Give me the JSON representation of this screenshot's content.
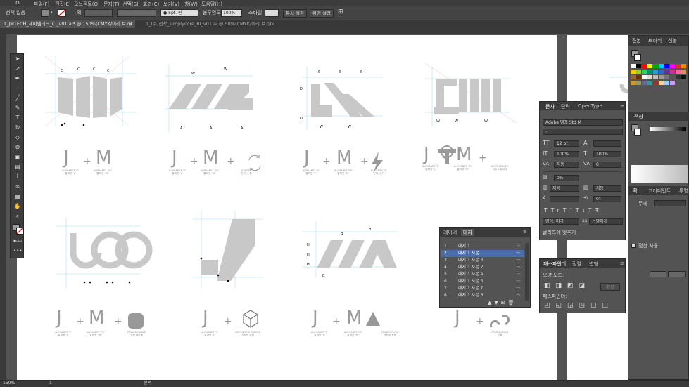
{
  "menubar": {
    "items": [
      "파일(F)",
      "편집(E)",
      "오브젝트(O)",
      "문자(T)",
      "선택(S)",
      "효과(C)",
      "보기(V)",
      "창(W)",
      "도움말(H)"
    ]
  },
  "control": {
    "selection": "선택 없음",
    "stroke_label": "획",
    "stroke_size": "5pt. 원",
    "opacity_label": "불투명도",
    "opacity_value": "100%",
    "style_label": "스타일",
    "doc_setup": "문서 설정",
    "preferences": "환경 설정"
  },
  "tabs": [
    {
      "label": "1_JMTECH_제이엠테크_CI_v01.ai* @ 150%(CMYK/미리 보기)",
      "close": "×"
    },
    {
      "label": "1_(주)선착_simplycore_BI_v01.ai @ 50%(CMYK/미리 보기)",
      "close": "×"
    }
  ],
  "artboard": {
    "row1": [
      {
        "glyphs": [
          "J",
          "+",
          "M"
        ],
        "labels": [
          "ALPHABET \"J\"\n알파벳 \"J\"",
          "ALPHABET \"M\"\n알파벳 \"M\""
        ],
        "extra": ""
      },
      {
        "glyphs": [
          "J",
          "+",
          "M",
          "+"
        ],
        "labels": [
          "ALPHABET \"J\"\n알파벳 \"J\"",
          "ALPHABET \"M\"\n알파벳 \"M\"",
          "REPEAT\n반복, 순환"
        ],
        "extra": "repeat"
      },
      {
        "glyphs": [
          "J",
          "+",
          "M",
          "+"
        ],
        "labels": [
          "ALPHABET \"J\"\n알파벳 \"J\"",
          "ALPHABET \"M\"\n알파벳 \"M\"",
          "ELECTRICAL\n전력, 전기"
        ],
        "extra": "bolt"
      },
      {
        "glyphs": [
          "J",
          "+",
          "M",
          "+"
        ],
        "labels": [
          "ALPHABET \"J\"\n알파벳 \"J\"",
          "ALPHABET \"M\"\n알파벳 \"M\"",
          "DUCT SPACER\n덕트 스페이서"
        ],
        "extra": "spacer"
      }
    ],
    "row2": [
      {
        "glyphs": [
          "J",
          "+",
          "M",
          "+"
        ],
        "labels": [
          "ALPHABET \"J\"\n알파벳 \"J\"",
          "ALPHABET \"M\"\n알파벳 \"M\"",
          "POWER CABLE\n전력 케이블"
        ],
        "extra": "cable"
      },
      {
        "glyphs": [
          "J",
          "+"
        ],
        "labels": [
          "ALPHABET \"J\"\n알파벳 \"J\"",
          "GEOMETRIC MOTIVE\n기하학 모형"
        ],
        "extra": "cube"
      },
      {
        "glyphs": [
          "J",
          "+",
          "M",
          "+"
        ],
        "labels": [
          "ALPHABET \"J\"\n알파벳 \"J\"",
          "ALPHABET \"M\"\n알파벳 \"M\"",
          "POWER FLOW\n전력의 흐름"
        ],
        "extra": "warn"
      },
      {
        "glyphs": [
          "J",
          "+"
        ],
        "labels": [
          "ALPHABET \"J\"\n알파벳 \"J\"",
          "CONNECTION\n연결"
        ],
        "extra": "link"
      }
    ],
    "dims": {
      "c": "C",
      "w": "W",
      "a": "A",
      "s": "S",
      "d": "D",
      "h": "H",
      "b": "B"
    }
  },
  "char_panel": {
    "tabs": [
      "문자",
      "단락",
      "OpenType"
    ],
    "font": "Adobe 명조 Std M",
    "style": "-",
    "size": "12 pt",
    "h_scale": "100%",
    "v_scale": "100%",
    "tracking": "자동",
    "kerning": "0",
    "baseline": "0%",
    "auto1": "자동",
    "auto2": "자동",
    "rotation": "0°",
    "lang": "영어: 미국",
    "aa": "선명하게",
    "glyph_label": "글리프에 맞추기"
  },
  "layers_panel": {
    "tabs": [
      "레이어",
      "대지"
    ],
    "rows": [
      {
        "num": "1",
        "name": "대지 1"
      },
      {
        "num": "2",
        "name": "대지 1 사본"
      },
      {
        "num": "3",
        "name": "대지 1 사본 3"
      },
      {
        "num": "4",
        "name": "대지 1 사본 2"
      },
      {
        "num": "5",
        "name": "대지 1 사본 4"
      },
      {
        "num": "6",
        "name": "대지 1 사본 5"
      },
      {
        "num": "7",
        "name": "대지 1 사본 7"
      },
      {
        "num": "8",
        "name": "대지 1 사본 6"
      }
    ]
  },
  "pathfinder_panel": {
    "tabs": [
      "패스파인더",
      "정렬",
      "변형"
    ],
    "shape_modes": "모양 모드:",
    "pathfinders": "패스파인더:",
    "expand": "확장"
  },
  "right_dock": {
    "tabs": [
      "견본",
      "브러쉬",
      "심볼"
    ],
    "color_tab": "색상",
    "appearance_tabs": [
      "획",
      "그라디언트",
      "투명"
    ],
    "weight_label": "두께",
    "stroke_check": "점선 사용"
  },
  "status": {
    "zoom": "150%",
    "page": "1",
    "tool": "선택"
  }
}
